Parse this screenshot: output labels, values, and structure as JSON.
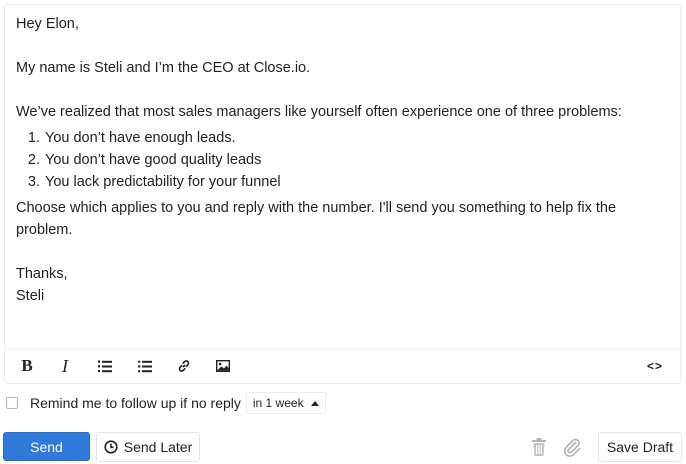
{
  "email": {
    "greeting": "Hey Elon,",
    "intro": "My name is Steli and I’m the CEO at Close.io.",
    "problem_intro": "We’ve realized that most sales managers like yourself often experience one of three problems:",
    "problems": [
      "You don’t have enough leads.",
      "You don’t have good quality leads",
      "You lack predictability for your funnel"
    ],
    "cta": "Choose which applies to you and reply with the number. I'll send you something to help fix the problem.",
    "signoff": "Thanks,",
    "signature": "Steli"
  },
  "toolbar": {
    "bold_label": "B",
    "italic_label": "I",
    "code_label": "<>",
    "icons": [
      "bold-icon",
      "italic-icon",
      "ordered-list-icon",
      "bullet-list-icon",
      "link-icon",
      "image-icon",
      "code-view-icon"
    ]
  },
  "followup": {
    "checked": false,
    "label": "Remind me to follow up if no reply",
    "selected_interval": "in 1 week"
  },
  "actions": {
    "send_label": "Send",
    "send_later_label": "Send Later",
    "save_draft_label": "Save Draft",
    "icons": [
      "clock-icon",
      "trash-icon",
      "paperclip-icon"
    ]
  },
  "colors": {
    "accent": "#2f7ad9",
    "border": "#e4e4e4"
  }
}
